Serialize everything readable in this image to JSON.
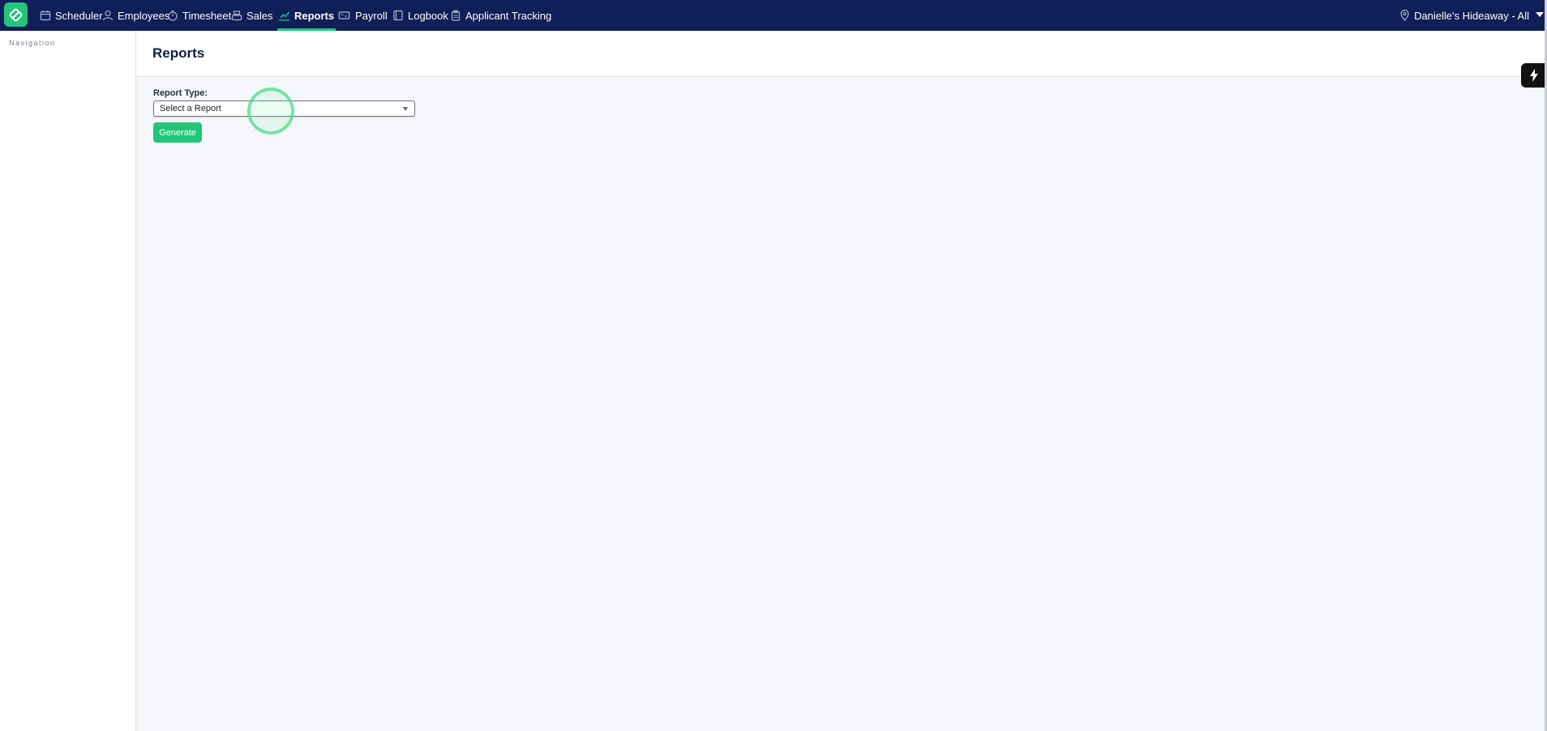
{
  "nav": {
    "items": [
      {
        "label": "Scheduler",
        "icon": "calendar-icon"
      },
      {
        "label": "Employees",
        "icon": "user-icon"
      },
      {
        "label": "Timesheet",
        "icon": "stopwatch-icon"
      },
      {
        "label": "Sales",
        "icon": "cash-register-icon"
      },
      {
        "label": "Reports",
        "icon": "trend-chart-icon",
        "active": true
      },
      {
        "label": "Payroll",
        "icon": "money-bill-icon"
      },
      {
        "label": "Logbook",
        "icon": "book-icon"
      },
      {
        "label": "Applicant Tracking",
        "icon": "clipboard-icon"
      }
    ],
    "location": "Danielle's Hideaway - All"
  },
  "sidebar": {
    "title": "Navigation"
  },
  "page": {
    "title": "Reports"
  },
  "form": {
    "report_type_label": "Report Type:",
    "select_value": "Select a Report",
    "generate_label": "Generate"
  },
  "colors": {
    "nav_bg": "#0f1f57",
    "accent": "#22c57a",
    "page_bg": "#f5f7fb"
  }
}
